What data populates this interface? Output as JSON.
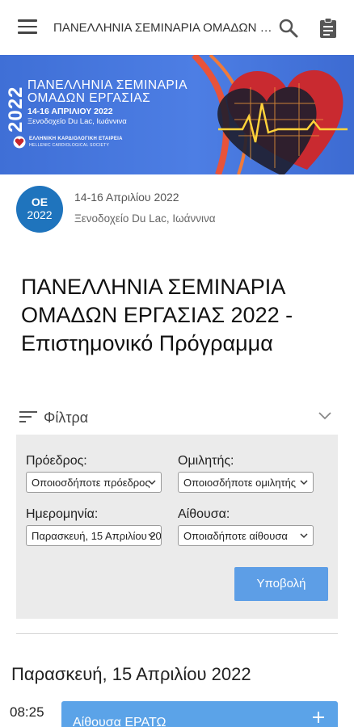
{
  "appbar": {
    "title": "ΠΑΝΕΛΛΗΝΙΑ ΣΕΜΙΝΑΡΙΑ ΟΜΑΔΩΝ ΕΡΓΑΣΙΑΣ 2022 - Επιστημονικό Πρόγραμμα",
    "icons": [
      "menu-icon",
      "search-icon",
      "clipboard-icon"
    ]
  },
  "banner": {
    "year": "2022",
    "title_line1": "ΠΑΝΕΛΛΗΝΙΑ ΣΕΜΙΝΑΡΙΑ",
    "title_line2": "ΟΜΑΔΩΝ ΕΡΓΑΣΙΑΣ",
    "dates": "14-16 ΑΠΡΙΛΙΟΥ 2022",
    "venue": "Ξενοδοχείο Du Lac, Ιωάννινα",
    "society_gr": "ΕΛΛΗΝΙΚΗ ΚΑΡΔΙΟΛΟΓΙΚΗ ΕΤΑΙΡΕΙΑ",
    "society_en": "HELLENIC CARDIOLOGICAL SOCIETY"
  },
  "event": {
    "badge_line1": "ΟΕ",
    "badge_line2": "2022",
    "date": "14-16 Απριλίου 2022",
    "venue": "Ξενοδοχείο Du Lac, Ιωάννινα",
    "title": "ΠΑΝΕΛΛΗΝΙΑ ΣΕΜΙΝΑΡΙΑ ΟΜΑΔΩΝ ΕΡΓΑΣΙΑΣ 2022 - Επιστημονικό Πρόγραμμα"
  },
  "filters": {
    "label": "Φίλτρα",
    "chair_label": "Πρόεδρος:",
    "chair_value": "Οποιοσδήποτε πρόεδρος",
    "speaker_label": "Ομιλητής:",
    "speaker_value": "Οποιοσδήποτε ομιλητής",
    "date_label": "Ημερομηνία:",
    "date_value": "Παρασκευή, 15 Απριλίου 2022",
    "room_label": "Αίθουσα:",
    "room_value": "Οποιαδήποτε αίθουσα",
    "submit_label": "Υποβολή"
  },
  "schedule": {
    "day_title": "Παρασκευή, 15 Απριλίου 2022",
    "sessions": [
      {
        "time": "08:25",
        "label": "Αίθουσα ΕΡΑΤΩ"
      }
    ]
  },
  "colors": {
    "accent": "#1f74bd",
    "submit": "#5d9ee6",
    "session": "#5ba3e8",
    "banner": "#4d7ee4"
  }
}
